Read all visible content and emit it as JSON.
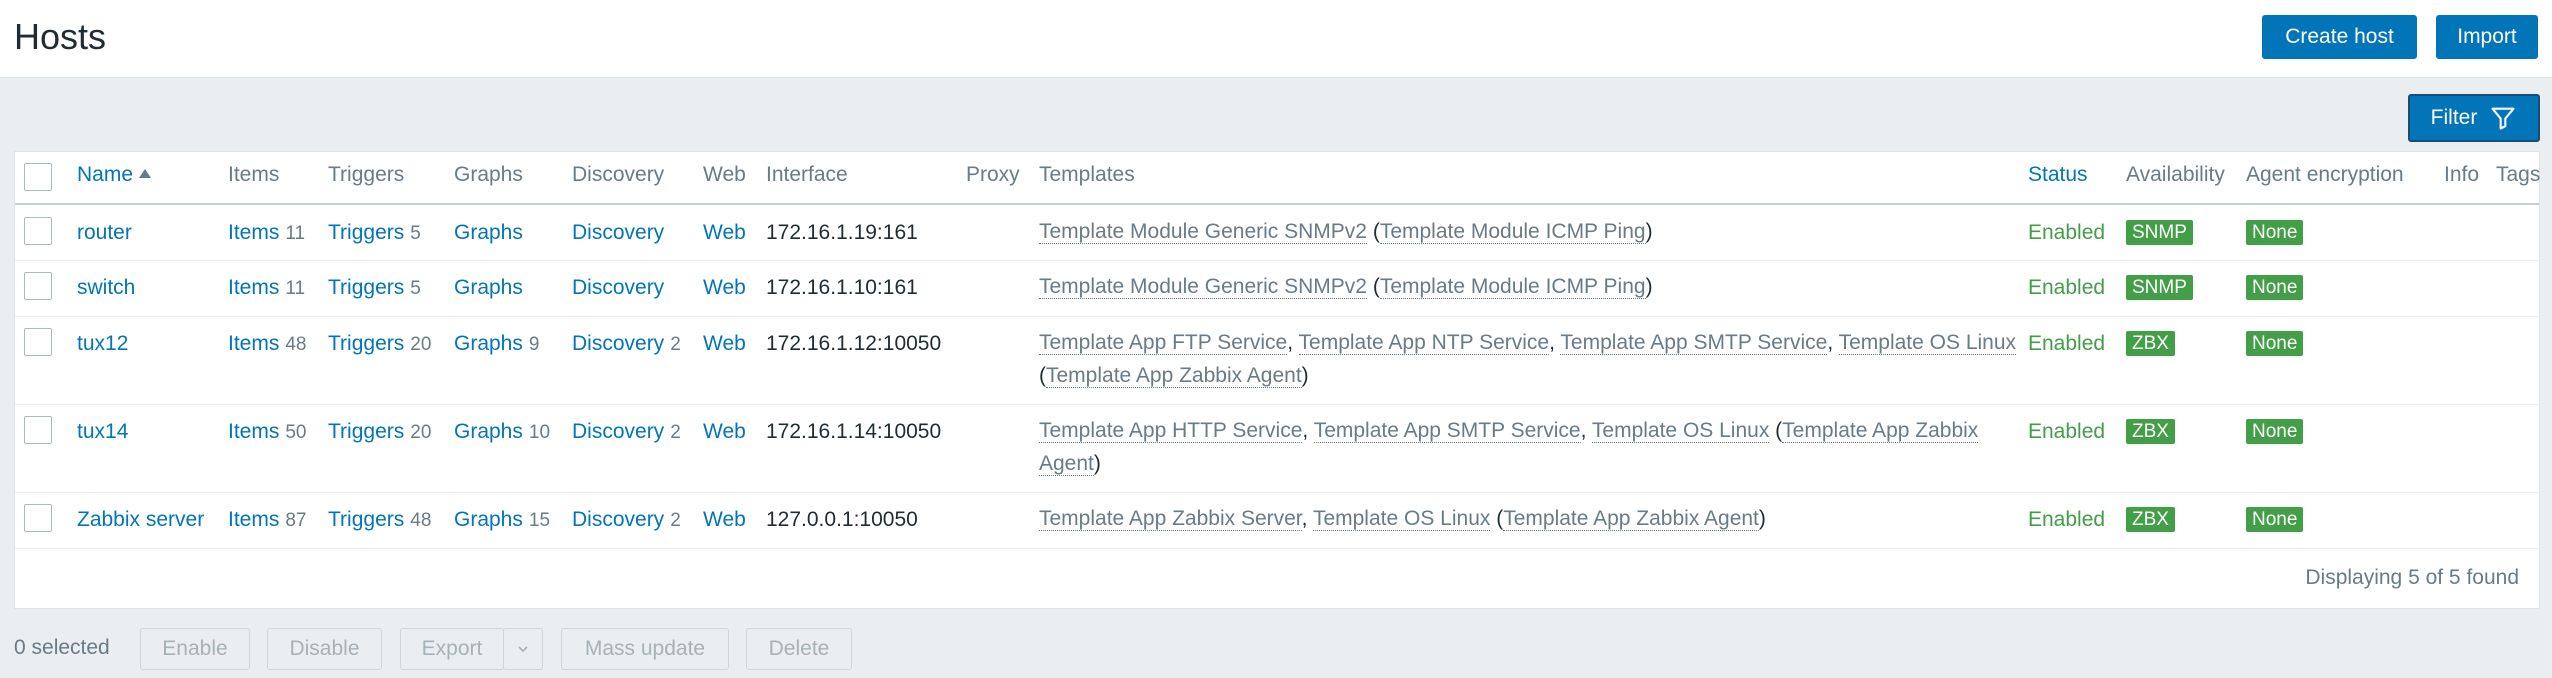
{
  "page": {
    "title": "Hosts"
  },
  "header_buttons": {
    "create_host": "Create host",
    "import": "Import"
  },
  "filter": {
    "label": "Filter",
    "icon": "filter-funnel-icon"
  },
  "table": {
    "columns": {
      "name": "Name",
      "items": "Items",
      "triggers": "Triggers",
      "graphs": "Graphs",
      "discovery": "Discovery",
      "web": "Web",
      "interface": "Interface",
      "proxy": "Proxy",
      "templates": "Templates",
      "status": "Status",
      "availability": "Availability",
      "agent_encryption": "Agent encryption",
      "info": "Info",
      "tags": "Tags"
    },
    "sort": {
      "column": "Name",
      "direction": "ascending"
    },
    "rows": [
      {
        "name": "router",
        "items_label": "Items",
        "items_count": "11",
        "triggers_label": "Triggers",
        "triggers_count": "5",
        "graphs_label": "Graphs",
        "graphs_count": "",
        "discovery_label": "Discovery",
        "discovery_count": "",
        "web_label": "Web",
        "interface": "172.16.1.19:161",
        "templates": [
          {
            "text": "Template Module Generic SNMPv2",
            "linked": true
          },
          {
            "text": " (",
            "linked": false
          },
          {
            "text": "Template Module ICMP Ping",
            "linked": true
          },
          {
            "text": ")",
            "linked": false
          }
        ],
        "status": "Enabled",
        "availability": "SNMP",
        "encryption": "None"
      },
      {
        "name": "switch",
        "items_label": "Items",
        "items_count": "11",
        "triggers_label": "Triggers",
        "triggers_count": "5",
        "graphs_label": "Graphs",
        "graphs_count": "",
        "discovery_label": "Discovery",
        "discovery_count": "",
        "web_label": "Web",
        "interface": "172.16.1.10:161",
        "templates": [
          {
            "text": "Template Module Generic SNMPv2",
            "linked": true
          },
          {
            "text": " (",
            "linked": false
          },
          {
            "text": "Template Module ICMP Ping",
            "linked": true
          },
          {
            "text": ")",
            "linked": false
          }
        ],
        "status": "Enabled",
        "availability": "SNMP",
        "encryption": "None"
      },
      {
        "name": "tux12",
        "items_label": "Items",
        "items_count": "48",
        "triggers_label": "Triggers",
        "triggers_count": "20",
        "graphs_label": "Graphs",
        "graphs_count": "9",
        "discovery_label": "Discovery",
        "discovery_count": "2",
        "web_label": "Web",
        "interface": "172.16.1.12:10050",
        "templates": [
          {
            "text": "Template App FTP Service",
            "linked": true
          },
          {
            "text": ", ",
            "linked": false
          },
          {
            "text": "Template App NTP Service",
            "linked": true
          },
          {
            "text": ", ",
            "linked": false
          },
          {
            "text": "Template App SMTP Service",
            "linked": true
          },
          {
            "text": ", ",
            "linked": false
          },
          {
            "text": "Template OS Linux",
            "linked": true
          },
          {
            "text": " (",
            "linked": false
          },
          {
            "text": "Template App Zabbix Agent",
            "linked": true
          },
          {
            "text": ")",
            "linked": false
          }
        ],
        "status": "Enabled",
        "availability": "ZBX",
        "encryption": "None"
      },
      {
        "name": "tux14",
        "items_label": "Items",
        "items_count": "50",
        "triggers_label": "Triggers",
        "triggers_count": "20",
        "graphs_label": "Graphs",
        "graphs_count": "10",
        "discovery_label": "Discovery",
        "discovery_count": "2",
        "web_label": "Web",
        "interface": "172.16.1.14:10050",
        "templates": [
          {
            "text": "Template App HTTP Service",
            "linked": true
          },
          {
            "text": ", ",
            "linked": false
          },
          {
            "text": "Template App SMTP Service",
            "linked": true
          },
          {
            "text": ", ",
            "linked": false
          },
          {
            "text": "Template OS Linux",
            "linked": true
          },
          {
            "text": " (",
            "linked": false
          },
          {
            "text": "Template App Zabbix Agent",
            "linked": true
          },
          {
            "text": ")",
            "linked": false
          }
        ],
        "status": "Enabled",
        "availability": "ZBX",
        "encryption": "None"
      },
      {
        "name": "Zabbix server",
        "items_label": "Items",
        "items_count": "87",
        "triggers_label": "Triggers",
        "triggers_count": "48",
        "graphs_label": "Graphs",
        "graphs_count": "15",
        "discovery_label": "Discovery",
        "discovery_count": "2",
        "web_label": "Web",
        "interface": "127.0.0.1:10050",
        "templates": [
          {
            "text": "Template App Zabbix Server",
            "linked": true
          },
          {
            "text": ", ",
            "linked": false
          },
          {
            "text": "Template OS Linux",
            "linked": true
          },
          {
            "text": " (",
            "linked": false
          },
          {
            "text": "Template App Zabbix Agent",
            "linked": true
          },
          {
            "text": ")",
            "linked": false
          }
        ],
        "status": "Enabled",
        "availability": "ZBX",
        "encryption": "None"
      }
    ],
    "paging_text": "Displaying 5 of 5 found"
  },
  "footer": {
    "selected_text": "0 selected",
    "buttons": {
      "enable": "Enable",
      "disable": "Disable",
      "export": "Export",
      "mass_update": "Mass update",
      "delete": "Delete"
    }
  },
  "colors": {
    "primary": "#0275b8",
    "enabled_green": "#429e47",
    "muted_text": "#687b87",
    "background": "#ebeef0"
  }
}
